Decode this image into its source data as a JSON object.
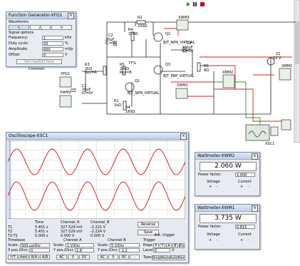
{
  "colors": {
    "wire_red": "#d42020",
    "wire_green": "#20a020",
    "wire_black": "#222222",
    "scope_bg": "#ffffff",
    "trace": "#d01010"
  },
  "toolbar": {
    "run_icon": "run-icon",
    "pause_icon": "pause-icon",
    "stop_icon": "stop-icon"
  },
  "funcgen": {
    "title": "Function Generator-XFG1",
    "waveforms_label": "Waveforms",
    "signal_options": "Signal options",
    "rows": [
      {
        "label": "Frequency:",
        "value": "1",
        "unit": "kHz"
      },
      {
        "label": "Duty cycle:",
        "value": "50",
        "unit": "%"
      },
      {
        "label": "Amplitude:",
        "value": "600",
        "unit": "mVp"
      },
      {
        "label": "Offset:",
        "value": "0",
        "unit": "V"
      }
    ],
    "set_rise_fall": "Set rise/Fall time",
    "common": "Common"
  },
  "schematic": {
    "labels": [
      {
        "t": "R2",
        "c": "black"
      },
      {
        "t": "200Ω",
        "c": "black"
      },
      {
        "t": "XWM3",
        "c": "black"
      },
      {
        "t": "C2",
        "c": "black"
      },
      {
        "t": "20µF",
        "c": "black"
      },
      {
        "t": "IC=0V",
        "c": "black"
      },
      {
        "t": "R4",
        "c": "black"
      },
      {
        "t": "270Ω",
        "c": "black"
      },
      {
        "t": "Q2",
        "c": "black"
      },
      {
        "t": "BJT_NPN_VIRTUAL",
        "c": "black"
      },
      {
        "t": "C3",
        "c": "black"
      },
      {
        "t": "200µF",
        "c": "black"
      },
      {
        "t": "IC=0V",
        "c": "black"
      },
      {
        "t": "R6",
        "c": "black"
      },
      {
        "t": "8Ω",
        "c": "black"
      },
      {
        "t": "V2",
        "c": "black"
      },
      {
        "t": "12 V",
        "c": "black"
      },
      {
        "t": "XMM1",
        "c": "black"
      },
      {
        "t": "R3",
        "c": "black"
      },
      {
        "t": "2kΩ",
        "c": "black"
      },
      {
        "t": "Key=A",
        "c": "black"
      },
      {
        "t": "R5",
        "c": "black"
      },
      {
        "t": "20kΩ",
        "c": "black"
      },
      {
        "t": "Key=B",
        "c": "black"
      },
      {
        "t": "77%",
        "c": "black"
      },
      {
        "t": "Q1",
        "c": "black"
      },
      {
        "t": "BJT_NPN_VIRTUAL",
        "c": "black"
      },
      {
        "t": "Q3",
        "c": "black"
      },
      {
        "t": "BJT_PNP_VIRTUAL",
        "c": "black"
      },
      {
        "t": "R1",
        "c": "black"
      },
      {
        "t": "1kΩ",
        "c": "black"
      },
      {
        "t": "XMM2",
        "c": "black"
      },
      {
        "t": "XWM1",
        "c": "black"
      },
      {
        "t": "XWM2",
        "c": "black"
      },
      {
        "t": "XFG1",
        "c": "black"
      },
      {
        "t": "C1",
        "c": "black"
      },
      {
        "t": "20µF",
        "c": "black"
      },
      {
        "t": "IC=0V",
        "c": "black"
      },
      {
        "t": "R4",
        "c": "black"
      },
      {
        "t": "180Ω",
        "c": "black"
      },
      {
        "t": "XSC1",
        "c": "black"
      }
    ]
  },
  "oscilloscope": {
    "title": "Oscilloscope-XSC1",
    "readout_headers": [
      "Time",
      "Channel_A",
      "Channel_B"
    ],
    "readout_rows": [
      {
        "name": "T1",
        "time": "5.451 s",
        "a": "327.529 mV",
        "b": "-2.221 V"
      },
      {
        "name": "T2",
        "time": "5.451 s",
        "a": "327.529 mV",
        "b": "-2.224 V"
      },
      {
        "name": "T2-T1",
        "time": "0.000 s",
        "a": "0.000 V",
        "b": "0.000 V"
      }
    ],
    "reverse": "Reverse",
    "save": "Save",
    "ext_trigger": "Ext. trigger",
    "timebase": {
      "label": "Timebase",
      "scale_label": "Scale:",
      "scale": "500 µs/Div",
      "xpos_label": "X pos.(Div):",
      "xpos": "0",
      "buttons": [
        "Y/T",
        "Add",
        "B/A",
        "A/B"
      ]
    },
    "channel_a": {
      "label": "Channel A",
      "scale_label": "Scale:",
      "scale": "1 V/Div",
      "ypos_label": "Y pos.(Div):",
      "ypos": "1.8",
      "buttons": [
        "AC",
        "0",
        "DC"
      ]
    },
    "channel_b": {
      "label": "Channel B",
      "scale_label": "Scale:",
      "scale": "5 V/Div",
      "ypos_label": "Y pos.(Div):",
      "ypos": "-1.2",
      "buttons": [
        "AC",
        "0",
        "DC",
        "-"
      ]
    },
    "trigger": {
      "label": "Trigger",
      "edge_label": "Edge:",
      "edge_buttons": [
        "F",
        "T",
        "A",
        "B",
        "Ext"
      ],
      "level_label": "Level:",
      "level": "0",
      "level_unit": "V",
      "type_label": "Type",
      "type_buttons": [
        "Sing.",
        "Nor.",
        "Auto",
        "None"
      ]
    }
  },
  "wattmeter2": {
    "title": "Wattmeter-XWM2",
    "reading": "2.060 W",
    "pf_label": "Power factor:",
    "pf": "1.000",
    "voltage": "Voltage",
    "current": "Current"
  },
  "wattmeter1": {
    "title": "Wattmeter-XWM1",
    "reading": "3.735 W",
    "pf_label": "Power factor:",
    "pf": "0.815",
    "voltage": "Voltage",
    "current": "Current"
  }
}
